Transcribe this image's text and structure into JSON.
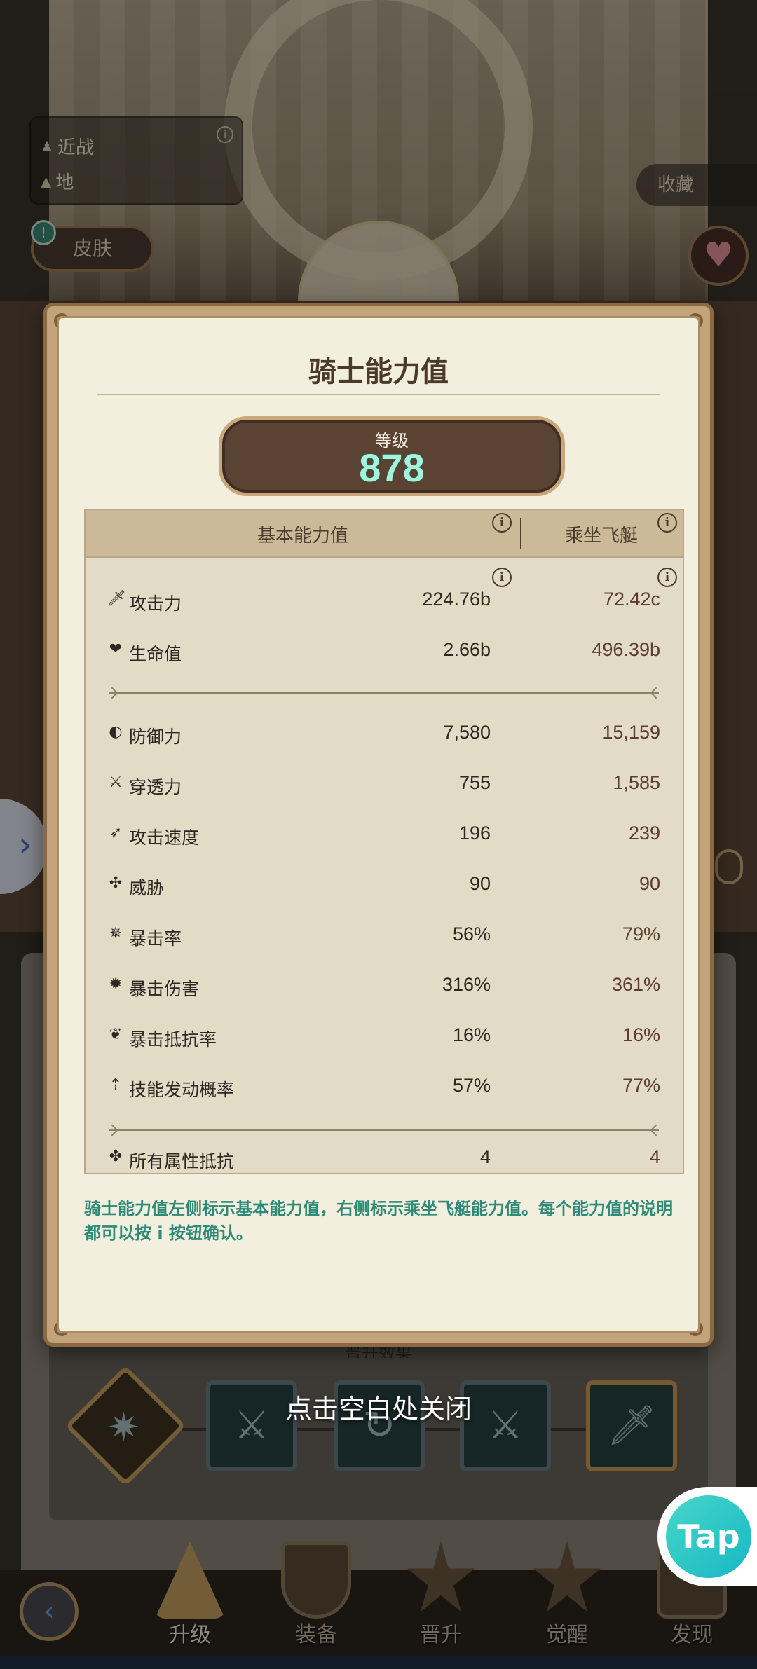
{
  "scene": {
    "info_box": {
      "attack_type": "近战",
      "terrain": "地"
    },
    "skin_button": "皮肤",
    "alert_badge": "!",
    "favorite_button": "收藏",
    "promotion_effect_partial": "晋升效果",
    "close_hint": "点击空白处关闭"
  },
  "bottom_nav": {
    "items": [
      {
        "label": "升级",
        "active": true
      },
      {
        "label": "装备",
        "active": false
      },
      {
        "label": "晋升",
        "active": false
      },
      {
        "label": "觉醒",
        "active": false
      },
      {
        "label": "发现",
        "active": false
      }
    ]
  },
  "tap_logo": "Tap",
  "modal": {
    "title": "骑士能力值",
    "level_label": "等级",
    "level_value": "878",
    "header": {
      "base": "基本能力值",
      "mount": "乘坐飞艇"
    },
    "stats": [
      {
        "icon": "sword-icon",
        "name": "攻击力",
        "base": "224.76b",
        "mount": "72.42c"
      },
      {
        "icon": "heart-icon",
        "name": "生命值",
        "base": "2.66b",
        "mount": "496.39b"
      },
      {
        "icon": "shield-icon",
        "name": "防御力",
        "base": "7,580",
        "mount": "15,159"
      },
      {
        "icon": "pierce-icon",
        "name": "穿透力",
        "base": "755",
        "mount": "1,585"
      },
      {
        "icon": "speed-icon",
        "name": "攻击速度",
        "base": "196",
        "mount": "239"
      },
      {
        "icon": "threat-icon",
        "name": "威胁",
        "base": "90",
        "mount": "90"
      },
      {
        "icon": "crit-icon",
        "name": "暴击率",
        "base": "56%",
        "mount": "79%"
      },
      {
        "icon": "crit-damage-icon",
        "name": "暴击伤害",
        "base": "316%",
        "mount": "361%"
      },
      {
        "icon": "crit-resist-icon",
        "name": "暴击抵抗率",
        "base": "16%",
        "mount": "16%"
      },
      {
        "icon": "skill-chance-icon",
        "name": "技能发动概率",
        "base": "57%",
        "mount": "77%"
      },
      {
        "icon": "element-resist-icon",
        "name": "所有属性抵抗",
        "base": "4",
        "mount": "4"
      }
    ],
    "note": "骑士能力值左侧标示基本能力值，右侧标示乘坐飞艇能力值。每个能力值的说明都可以按 i 按钮确认。"
  },
  "colors": {
    "level_value": "#a2f4de",
    "note_text": "#2f8a78",
    "mount_value": "#5e3d2e"
  }
}
